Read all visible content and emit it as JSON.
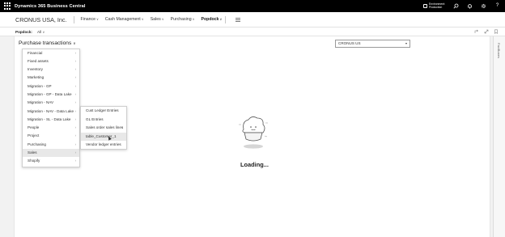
{
  "app": {
    "title": "Dynamics 365 Business Central"
  },
  "topbar": {
    "environment_line1": "Environment:",
    "environment_line2": "Production",
    "icons": [
      "environment-icon",
      "search-icon",
      "bell-icon",
      "gear-icon",
      "help-icon"
    ]
  },
  "navbar": {
    "company": "CRONUS USA, Inc.",
    "items": [
      {
        "label": "Finance",
        "chevron": "∨"
      },
      {
        "label": "Cash Management",
        "chevron": "∨"
      },
      {
        "label": "Sales",
        "chevron": "∨"
      },
      {
        "label": "Purchasing",
        "chevron": "∨"
      },
      {
        "label": "Popdock",
        "chevron": "∨"
      }
    ]
  },
  "action_bar": {
    "label": "Popdock:",
    "value": "All",
    "chevron": "∨"
  },
  "page": {
    "dropdown_title": "Purchase transactions",
    "dropdown_chevron": "∨",
    "company_select": "CRONUS US",
    "company_select_arrow": "▾",
    "side_panel_label": "FactBoxes",
    "loading": "Loading..."
  },
  "menu1": {
    "items": [
      {
        "label": "Financial",
        "arrow": "›"
      },
      {
        "label": "Fixed assets",
        "arrow": "›"
      },
      {
        "label": "Inventory",
        "arrow": "›"
      },
      {
        "label": "Marketing",
        "arrow": "›"
      },
      {
        "label": "Migration - GP",
        "arrow": "›"
      },
      {
        "label": "Migration - GP - Data Lake",
        "arrow": "›"
      },
      {
        "label": "Migration - NAV",
        "arrow": "›"
      },
      {
        "label": "Migration - NAV - Data Lake",
        "arrow": "›"
      },
      {
        "label": "Migration - SL - Data Lake",
        "arrow": "›"
      },
      {
        "label": "People",
        "arrow": "›"
      },
      {
        "label": "Project",
        "arrow": "›"
      },
      {
        "label": "Purchasing",
        "arrow": "›"
      },
      {
        "label": "Sales",
        "arrow": "›"
      },
      {
        "label": "Shopify",
        "arrow": "›"
      }
    ]
  },
  "menu2": {
    "items": [
      {
        "label": "Cust Ledger Entries",
        "arrow": ""
      },
      {
        "label": "GL Entries",
        "arrow": ""
      },
      {
        "label": "Sales order sales lines",
        "arrow": "›"
      },
      {
        "label": "table_Customer_1",
        "arrow": ""
      },
      {
        "label": "Vendor ledger entries",
        "arrow": ""
      }
    ]
  }
}
